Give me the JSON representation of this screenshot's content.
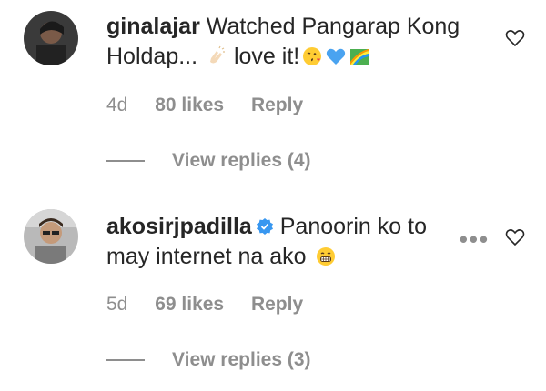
{
  "comments": [
    {
      "username": "ginalajar",
      "text_line1": "Watched Pangarap Kong",
      "text_line2": "Holdap...",
      "text_line2b": "love it!",
      "age": "4d",
      "likes": "80 likes",
      "reply": "Reply",
      "view_replies": "View replies (4)",
      "emojis": [
        "clapping-hands-icon",
        "face-blowing-kiss-icon",
        "blue-heart-icon",
        "rainbow-flag-icon"
      ]
    },
    {
      "username": "akosirjpadilla",
      "verified": true,
      "text_line1": "Panoorin ko to",
      "text_line2": "may internet na ako",
      "age": "5d",
      "likes": "69 likes",
      "reply": "Reply",
      "view_replies": "View replies (3)",
      "more_label": "•••",
      "emojis": [
        "grinning-face-icon"
      ]
    }
  ],
  "colors": {
    "text": "#262626",
    "secondary": "#8e8e8e",
    "verified": "#3897f0"
  }
}
